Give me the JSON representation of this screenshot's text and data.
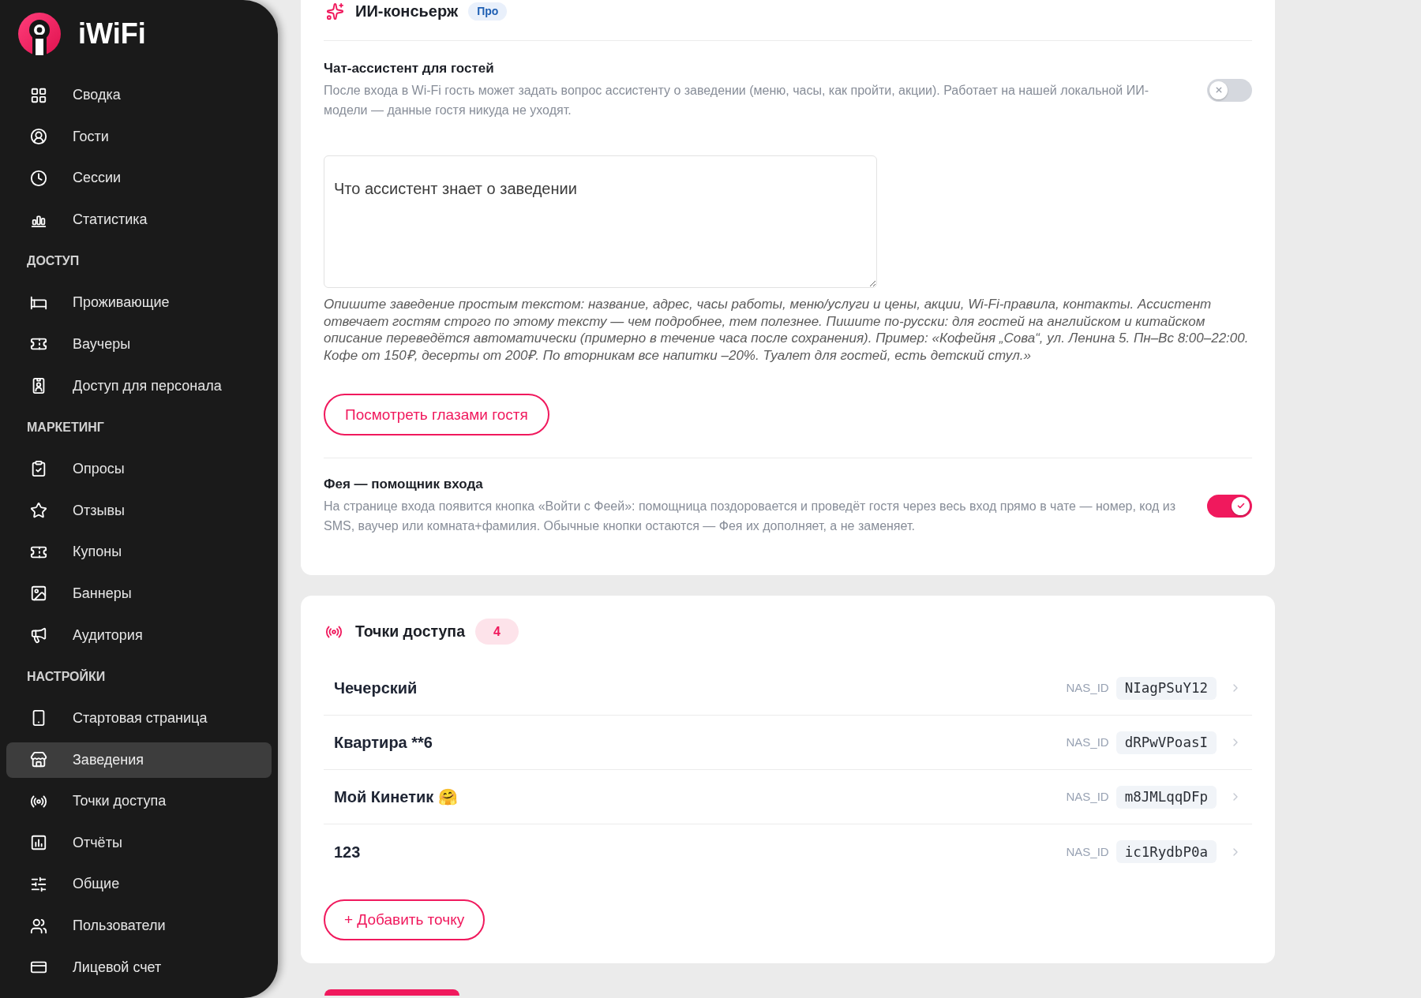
{
  "sidebar": {
    "brand": "iWiFi",
    "groups": [
      {
        "items": [
          {
            "label": "Сводка",
            "selected": false
          },
          {
            "label": "Гости",
            "selected": false
          },
          {
            "label": "Сессии",
            "selected": false
          },
          {
            "label": "Статистика",
            "selected": false
          }
        ]
      },
      {
        "heading": "ДОСТУП",
        "items": [
          {
            "label": "Проживающие",
            "selected": false
          },
          {
            "label": "Ваучеры",
            "selected": false
          },
          {
            "label": "Доступ для персонала",
            "selected": false
          }
        ]
      },
      {
        "heading": "МАРКЕТИНГ",
        "items": [
          {
            "label": "Опросы",
            "selected": false
          },
          {
            "label": "Отзывы",
            "selected": false
          },
          {
            "label": "Купоны",
            "selected": false
          },
          {
            "label": "Баннеры",
            "selected": false
          },
          {
            "label": "Аудитория",
            "selected": false
          }
        ]
      },
      {
        "heading": "НАСТРОЙКИ",
        "items": [
          {
            "label": "Стартовая страница",
            "selected": false
          },
          {
            "label": "Заведения",
            "selected": true
          },
          {
            "label": "Точки доступа",
            "selected": false
          },
          {
            "label": "Отчёты",
            "selected": false
          },
          {
            "label": "Общие",
            "selected": false
          },
          {
            "label": "Пользователи",
            "selected": false
          },
          {
            "label": "Лицевой счет",
            "selected": false
          }
        ]
      }
    ]
  },
  "ai_concierge": {
    "title": "ИИ-консьерж",
    "badge": "Про",
    "chat_assistant": {
      "title": "Чат-ассистент для гостей",
      "description": "После входа в Wi-Fi гость может задать вопрос ассистенту о заведении (меню, часы, как пройти, акции). Работает на нашей локальной ИИ-модели — данные гостя никуда не уходят.",
      "on": false
    },
    "knowledge_field": {
      "placeholder": "Что ассистент знает о заведении",
      "hint": "Опишите заведение простым текстом: название, адрес, часы работы, меню/услуги и цены, акции, Wi-Fi-правила, контакты. Ассистент отвечает гостям строго по этому тексту — чем подробнее, тем полезнее. Пишите по-русски: для гостей на английском и китайском описание переведётся автоматически (примерно в течение часа после сохранения). Пример: «Кофейня „Сова“, ул. Ленина 5. Пн–Вс 8:00–22:00. Кофе от 150₽, десерты от 200₽. По вторникам все напитки –20%. Туалет для гостей, есть детский стул.»"
    },
    "preview_button": "Посмотреть глазами гостя",
    "login_fairy": {
      "title": "Фея — помощник входа",
      "description": "На странице входа появится кнопка «Войти с Феей»: помощница поздоровается и проведёт гостя через весь вход прямо в чате — номер, код из SMS, ваучер или комната+фамилия. Обычные кнопки остаются — Фея их дополняет, а не заменяет.",
      "on": true
    }
  },
  "access_points": {
    "title": "Точки доступа",
    "count": "4",
    "rows": [
      {
        "name": "Чечерский",
        "nas_id_label": "NAS_ID",
        "nas_id": "NIagPSuY12"
      },
      {
        "name": "Квартира **6",
        "nas_id_label": "NAS_ID",
        "nas_id": "dRPwVPoasI"
      },
      {
        "name": "Мой Кинетик 🤗",
        "nas_id_label": "NAS_ID",
        "nas_id": "m8JMLqqDFp"
      },
      {
        "name": "123",
        "nas_id_label": "NAS_ID",
        "nas_id": "ic1RydbP0a"
      }
    ],
    "add_button": "+ Добавить точку"
  }
}
